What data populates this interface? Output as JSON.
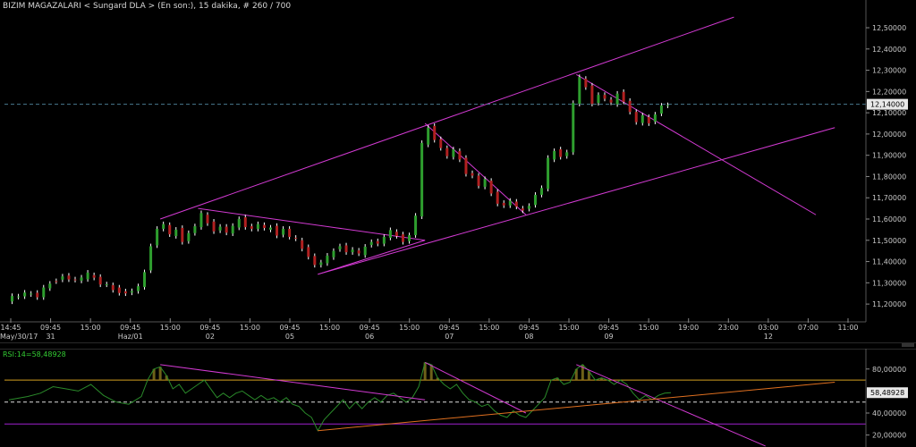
{
  "header": {
    "title": "BIZIM MAGAZALARI < Sungard DLA > (En son:), 15 dakika, # 260 / 700"
  },
  "rsi_panel": {
    "label": "RSI:14=58,48928"
  },
  "colors": {
    "up": "#2e9e2e",
    "down": "#b02020",
    "wick": "#ffffff",
    "trend": "#d23ad2",
    "rsi": "#2a8a2a",
    "upper_band": "#d4a020",
    "lower_band": "#a020d0",
    "orange": "#e07020",
    "axis_text": "#c8c8c8",
    "grid": "#1c1c1c"
  },
  "chart_data": [
    {
      "type": "candlestick",
      "title": "BIZIM MAGAZALARI < Sungard DLA > (En son:), 15 dakika, # 260 / 700",
      "ylim": [
        11.15,
        12.58
      ],
      "y_ticks": [
        "12,50000",
        "12,40000",
        "12,30000",
        "12,20000",
        "12,10000",
        "12,00000",
        "11,90000",
        "11,80000",
        "11,70000",
        "11,60000",
        "11,50000",
        "11,40000",
        "11,30000",
        "11,20000"
      ],
      "y_tick_values": [
        12.5,
        12.4,
        12.3,
        12.2,
        12.1,
        12.0,
        11.9,
        11.8,
        11.7,
        11.6,
        11.5,
        11.4,
        11.3,
        11.2
      ],
      "x_ticks": [
        {
          "label": "14:45",
          "date": "May/30/17"
        },
        {
          "label": "09:45",
          "date": "31"
        },
        {
          "label": "15:00",
          "date": ""
        },
        {
          "label": "09:45",
          "date": "Haz/01"
        },
        {
          "label": "15:00",
          "date": ""
        },
        {
          "label": "09:45",
          "date": "02"
        },
        {
          "label": "15:00",
          "date": ""
        },
        {
          "label": "09:45",
          "date": "05"
        },
        {
          "label": "15:00",
          "date": ""
        },
        {
          "label": "09:45",
          "date": "06"
        },
        {
          "label": "15:00",
          "date": ""
        },
        {
          "label": "09:45",
          "date": "07"
        },
        {
          "label": "15:00",
          "date": ""
        },
        {
          "label": "09:45",
          "date": "08"
        },
        {
          "label": "15:00",
          "date": ""
        },
        {
          "label": "09:45",
          "date": "09"
        },
        {
          "label": "15:00",
          "date": ""
        },
        {
          "label": "19:00",
          "date": ""
        },
        {
          "label": "23:00",
          "date": ""
        },
        {
          "label": "03:00",
          "date": "12"
        },
        {
          "label": "07:00",
          "date": ""
        },
        {
          "label": "11:00",
          "date": ""
        }
      ],
      "last_price": 12.14,
      "last_price_label": "12,14000",
      "price_path": [
        [
          0,
          11.22
        ],
        [
          3,
          11.25
        ],
        [
          5,
          11.24
        ],
        [
          7,
          11.3
        ],
        [
          9,
          11.33
        ],
        [
          11,
          11.31
        ],
        [
          13,
          11.34
        ],
        [
          15,
          11.3
        ],
        [
          17,
          11.27
        ],
        [
          19,
          11.25
        ],
        [
          21,
          11.28
        ],
        [
          22,
          11.35
        ],
        [
          23,
          11.48
        ],
        [
          24,
          11.55
        ],
        [
          25,
          11.58
        ],
        [
          26,
          11.52
        ],
        [
          27,
          11.55
        ],
        [
          28,
          11.5
        ],
        [
          29,
          11.53
        ],
        [
          30,
          11.57
        ],
        [
          31,
          11.62
        ],
        [
          32,
          11.58
        ],
        [
          33,
          11.55
        ],
        [
          34,
          11.56
        ],
        [
          35,
          11.54
        ],
        [
          36,
          11.56
        ],
        [
          37,
          11.6
        ],
        [
          38,
          11.57
        ],
        [
          39,
          11.55
        ],
        [
          40,
          11.58
        ],
        [
          41,
          11.55
        ],
        [
          42,
          11.56
        ],
        [
          43,
          11.53
        ],
        [
          44,
          11.55
        ],
        [
          45,
          11.52
        ],
        [
          46,
          11.5
        ],
        [
          47,
          11.46
        ],
        [
          48,
          11.43
        ],
        [
          49,
          11.38
        ],
        [
          50,
          11.4
        ],
        [
          51,
          11.42
        ],
        [
          52,
          11.45
        ],
        [
          53,
          11.48
        ],
        [
          54,
          11.44
        ],
        [
          55,
          11.46
        ],
        [
          56,
          11.43
        ],
        [
          57,
          11.47
        ],
        [
          58,
          11.5
        ],
        [
          59,
          11.48
        ],
        [
          60,
          11.52
        ],
        [
          61,
          11.54
        ],
        [
          62,
          11.52
        ],
        [
          63,
          11.5
        ],
        [
          64,
          11.52
        ],
        [
          65,
          11.62
        ],
        [
          66,
          11.95
        ],
        [
          67,
          12.03
        ],
        [
          68,
          11.98
        ],
        [
          69,
          11.93
        ],
        [
          70,
          11.9
        ],
        [
          71,
          11.92
        ],
        [
          72,
          11.88
        ],
        [
          73,
          11.82
        ],
        [
          74,
          11.8
        ],
        [
          75,
          11.76
        ],
        [
          76,
          11.78
        ],
        [
          77,
          11.72
        ],
        [
          78,
          11.68
        ],
        [
          79,
          11.66
        ],
        [
          80,
          11.69
        ],
        [
          81,
          11.65
        ],
        [
          82,
          11.64
        ],
        [
          83,
          11.67
        ],
        [
          84,
          11.71
        ],
        [
          85,
          11.75
        ],
        [
          86,
          11.88
        ],
        [
          87,
          11.92
        ],
        [
          88,
          11.9
        ],
        [
          89,
          11.91
        ],
        [
          90,
          12.15
        ],
        [
          91,
          12.26
        ],
        [
          92,
          12.22
        ],
        [
          93,
          12.15
        ],
        [
          94,
          12.18
        ],
        [
          95,
          12.17
        ],
        [
          96,
          12.14
        ],
        [
          97,
          12.19
        ],
        [
          98,
          12.16
        ],
        [
          99,
          12.1
        ],
        [
          100,
          12.06
        ],
        [
          101,
          12.08
        ],
        [
          102,
          12.05
        ],
        [
          103,
          12.1
        ],
        [
          104,
          12.13
        ],
        [
          105,
          12.14
        ]
      ]
    },
    {
      "type": "line",
      "name": "RSI:14=58,48928",
      "ylim": [
        14,
        92
      ],
      "y_ticks": [
        "80,00000",
        "58,48928",
        "40,00000",
        "20,00000"
      ],
      "y_tick_values": [
        80,
        58.48928,
        40,
        20
      ],
      "levels": {
        "upper": 70,
        "mid": 50,
        "lower": 30
      },
      "last_value": 58.48928,
      "values": [
        [
          0,
          52
        ],
        [
          3,
          55
        ],
        [
          5,
          58
        ],
        [
          7,
          64
        ],
        [
          9,
          62
        ],
        [
          11,
          60
        ],
        [
          13,
          66
        ],
        [
          15,
          56
        ],
        [
          17,
          50
        ],
        [
          19,
          48
        ],
        [
          21,
          55
        ],
        [
          22,
          70
        ],
        [
          23,
          80
        ],
        [
          24,
          82
        ],
        [
          25,
          74
        ],
        [
          26,
          62
        ],
        [
          27,
          66
        ],
        [
          28,
          58
        ],
        [
          29,
          62
        ],
        [
          30,
          66
        ],
        [
          31,
          70
        ],
        [
          32,
          62
        ],
        [
          33,
          54
        ],
        [
          34,
          58
        ],
        [
          35,
          54
        ],
        [
          36,
          58
        ],
        [
          37,
          60
        ],
        [
          38,
          56
        ],
        [
          39,
          52
        ],
        [
          40,
          56
        ],
        [
          41,
          52
        ],
        [
          42,
          54
        ],
        [
          43,
          50
        ],
        [
          44,
          54
        ],
        [
          45,
          48
        ],
        [
          46,
          46
        ],
        [
          47,
          40
        ],
        [
          48,
          36
        ],
        [
          49,
          24
        ],
        [
          50,
          34
        ],
        [
          51,
          40
        ],
        [
          52,
          46
        ],
        [
          53,
          52
        ],
        [
          54,
          44
        ],
        [
          55,
          50
        ],
        [
          56,
          44
        ],
        [
          57,
          50
        ],
        [
          58,
          54
        ],
        [
          59,
          50
        ],
        [
          60,
          56
        ],
        [
          61,
          58
        ],
        [
          62,
          54
        ],
        [
          63,
          50
        ],
        [
          64,
          54
        ],
        [
          65,
          64
        ],
        [
          66,
          86
        ],
        [
          67,
          84
        ],
        [
          68,
          72
        ],
        [
          69,
          66
        ],
        [
          70,
          62
        ],
        [
          71,
          66
        ],
        [
          72,
          58
        ],
        [
          73,
          52
        ],
        [
          74,
          50
        ],
        [
          75,
          46
        ],
        [
          76,
          48
        ],
        [
          77,
          42
        ],
        [
          78,
          38
        ],
        [
          79,
          36
        ],
        [
          80,
          42
        ],
        [
          81,
          38
        ],
        [
          82,
          36
        ],
        [
          83,
          42
        ],
        [
          84,
          48
        ],
        [
          85,
          54
        ],
        [
          86,
          70
        ],
        [
          87,
          72
        ],
        [
          88,
          66
        ],
        [
          89,
          68
        ],
        [
          90,
          80
        ],
        [
          91,
          84
        ],
        [
          92,
          78
        ],
        [
          93,
          70
        ],
        [
          94,
          72
        ],
        [
          95,
          70
        ],
        [
          96,
          66
        ],
        [
          97,
          70
        ],
        [
          98,
          66
        ],
        [
          99,
          58
        ],
        [
          100,
          52
        ],
        [
          101,
          56
        ],
        [
          102,
          52
        ],
        [
          103,
          56
        ],
        [
          104,
          58
        ],
        [
          105,
          58.5
        ]
      ]
    }
  ]
}
